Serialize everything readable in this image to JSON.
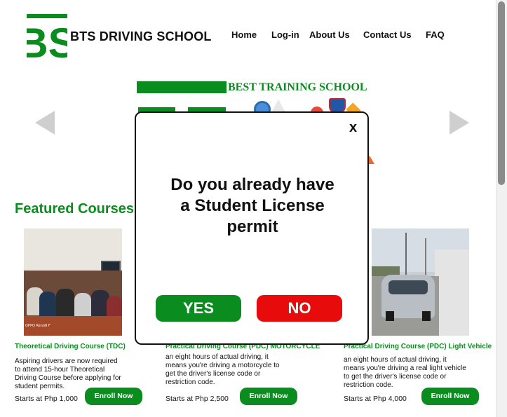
{
  "brand": {
    "name": "BTS DRIVING SCHOOL",
    "logo_text": "BS"
  },
  "nav": {
    "items": [
      "Home",
      "Log-in",
      "About Us",
      "Contact Us",
      "FAQ"
    ]
  },
  "banner": {
    "title": "BEST TRAINING SCHOOL"
  },
  "featured": {
    "title": "Featured Courses"
  },
  "courses": [
    {
      "title": "Theoretical Driving Course (TDC)",
      "description": [
        "Aspiring drivers are now required",
        "to attend 15-hour Theoretical",
        "Driving Course before applying for",
        "student permits."
      ],
      "price": "Starts at Php 1,000",
      "button": "Enroll Now",
      "photo_caption": "OPPO Reno8 F"
    },
    {
      "title": "Practical Driving Course (PDC) MOTORCYCLE",
      "description": [
        "an eight hours of actual driving, it",
        "means you're driving a motorcycle to",
        "get the driver's license code or",
        "restriction code."
      ],
      "price": "Starts at Php 2,500",
      "button": "Enroll Now"
    },
    {
      "title": "Practical Driving Course (PDC) Light Vehicle",
      "description": [
        "an eight hours of actual driving, it",
        "means you're driving a real light vehicle",
        "to get the driver's license code or",
        "restriction code."
      ],
      "price": "Starts at Php 4,000",
      "button": "Enroll Now"
    }
  ],
  "modal": {
    "close": "x",
    "question_lines": [
      "Do you already have",
      "a Student License",
      "permit"
    ],
    "yes": "YES",
    "no": "NO"
  },
  "colors": {
    "brand_green": "#0a8d1e",
    "no_red": "#e80b0b"
  },
  "icons": [
    "logo-icon",
    "arrow-left-icon",
    "arrow-right-icon"
  ]
}
